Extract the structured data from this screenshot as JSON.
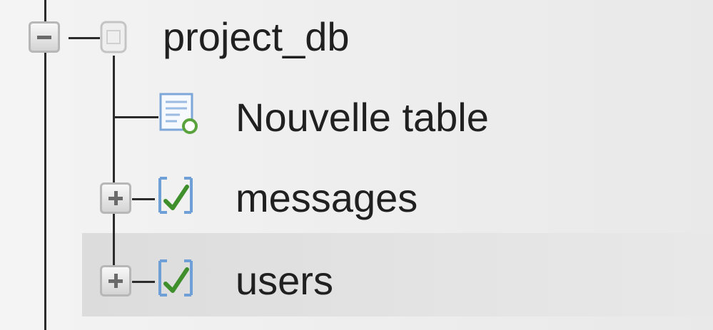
{
  "tree": {
    "database": {
      "name": "project_db",
      "expanded": true,
      "icon": "database-icon"
    },
    "children": [
      {
        "label": "Nouvelle table",
        "icon": "new-table-icon",
        "expandable": false
      },
      {
        "label": "messages",
        "icon": "table-icon",
        "expandable": true,
        "expanded": false
      },
      {
        "label": "users",
        "icon": "table-icon",
        "expandable": true,
        "expanded": false
      }
    ]
  },
  "colors": {
    "line": "#2b2b2b",
    "text": "#202020",
    "icon_blue": "#6e9fd6",
    "check_green": "#3f8f2c",
    "new_badge_green": "#5aa33c",
    "selected_row": "#dcdcdc"
  }
}
